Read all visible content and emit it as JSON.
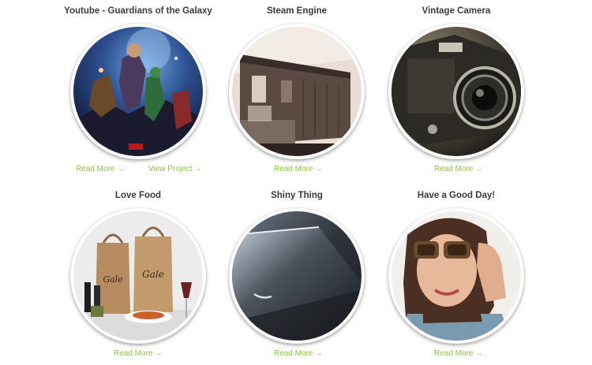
{
  "colors": {
    "link": "#8cc63f",
    "title": "#3b3b3b"
  },
  "items": [
    {
      "title": "Youtube - Guardians of the Galaxy",
      "image": "guardians-poster-image",
      "links": [
        {
          "label": "Read More",
          "arrow": "→"
        },
        {
          "label": "View Project",
          "arrow": "→"
        }
      ]
    },
    {
      "title": "Steam Engine",
      "image": "train-car-image",
      "links": [
        {
          "label": "Read More",
          "arrow": "→"
        }
      ]
    },
    {
      "title": "Vintage Camera",
      "image": "camera-lens-image",
      "links": [
        {
          "label": "Read More",
          "arrow": "→"
        }
      ]
    },
    {
      "title": "Love Food",
      "image": "food-bags-image",
      "links": [
        {
          "label": "Read More",
          "arrow": "→"
        }
      ]
    },
    {
      "title": "Shiny Thing",
      "image": "phone-closeup-image",
      "links": [
        {
          "label": "Read More",
          "arrow": "→"
        }
      ]
    },
    {
      "title": "Have a Good Day!",
      "image": "woman-sunglasses-image",
      "links": [
        {
          "label": "Read More",
          "arrow": "→"
        }
      ]
    }
  ]
}
